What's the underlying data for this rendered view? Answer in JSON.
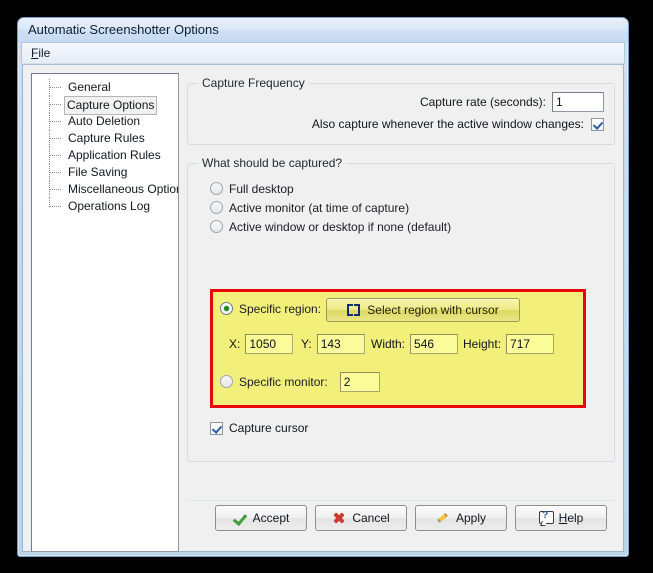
{
  "window": {
    "title": "Automatic Screenshotter Options",
    "menu": [
      {
        "label": "File",
        "accel": "F"
      }
    ]
  },
  "sidebar": {
    "items": [
      {
        "label": "General",
        "selected": false
      },
      {
        "label": "Capture Options",
        "selected": true
      },
      {
        "label": "Auto Deletion",
        "selected": false
      },
      {
        "label": "Capture Rules",
        "selected": false
      },
      {
        "label": "Application Rules",
        "selected": false
      },
      {
        "label": "File Saving",
        "selected": false
      },
      {
        "label": "Miscellaneous Options",
        "selected": false
      },
      {
        "label": "Operations Log",
        "selected": false
      }
    ]
  },
  "capture_frequency": {
    "title": "Capture Frequency",
    "rate_label": "Capture rate (seconds):",
    "rate_value": "1",
    "active_window_label": "Also capture whenever the active window changes:",
    "active_window_checked": true
  },
  "what_captured": {
    "title": "What should be captured?",
    "options": [
      {
        "label": "Full desktop",
        "selected": false
      },
      {
        "label": "Active monitor (at time of capture)",
        "selected": false
      },
      {
        "label": "Active window or desktop if none (default)",
        "selected": false
      },
      {
        "label": "Specific region:",
        "selected": true
      },
      {
        "label": "Specific monitor:",
        "selected": false
      }
    ],
    "select_region_button": "Select region with cursor",
    "select_region_icon": "crop-marks-icon",
    "region": {
      "x_label": "X:",
      "x_value": "1050",
      "y_label": "Y:",
      "y_value": "143",
      "width_label": "Width:",
      "width_value": "546",
      "height_label": "Height:",
      "height_value": "717"
    },
    "monitor_value": "2",
    "capture_cursor_label": "Capture cursor",
    "capture_cursor_checked": true,
    "highlight_color": "#f2f07b",
    "highlight_border_color": "#e90606"
  },
  "buttons": {
    "accept": {
      "label": "Accept",
      "icon": "green-check-icon"
    },
    "cancel": {
      "label": "Cancel",
      "icon": "red-x-icon"
    },
    "apply": {
      "label": "Apply",
      "icon": "pencil-icon"
    },
    "help": {
      "label": "Help",
      "accel": "H",
      "icon": "question-bubble-icon"
    }
  }
}
